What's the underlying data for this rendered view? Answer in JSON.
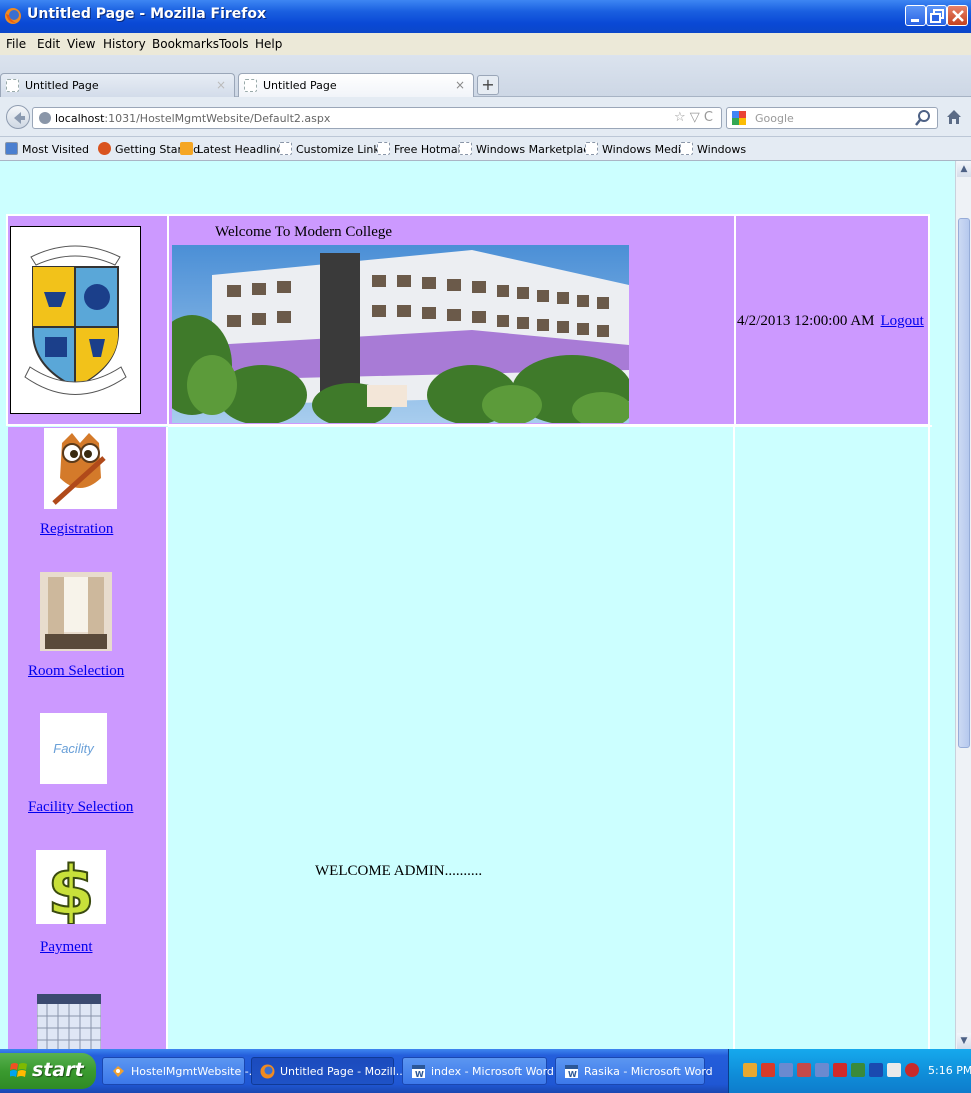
{
  "window": {
    "title": "Untitled Page - Mozilla Firefox"
  },
  "menu": [
    "File",
    "Edit",
    "View",
    "History",
    "Bookmarks",
    "Tools",
    "Help"
  ],
  "tabs": [
    {
      "label": "Untitled Page",
      "active": false
    },
    {
      "label": "Untitled Page",
      "active": true
    }
  ],
  "tab_close": "×",
  "new_tab": "+",
  "nav": {
    "url_host": "localhost",
    "url_path": ":1031/HostelMgmtWebsite/Default2.aspx",
    "url_tools": "☆ ▽ C",
    "search_placeholder": "Google"
  },
  "bookmarks": [
    "Most Visited",
    "Getting Started",
    "Latest Headlines",
    "Customize Links",
    "Free Hotmail",
    "Windows Marketplace",
    "Windows Media",
    "Windows"
  ],
  "page": {
    "welcome_college": "Welcome To Modern College",
    "datetime": "4/2/2013 12:00:00 AM",
    "logout": "Logout",
    "side_links": [
      "Registration",
      "Room Selection",
      "Facility Selection",
      "Payment"
    ],
    "facility_img_text": "Facility",
    "welcome_admin": "WELCOME ADMIN.........."
  },
  "taskbar": {
    "start": "start",
    "buttons": [
      {
        "label": "HostelMgmtWebsite -...",
        "active": false
      },
      {
        "label": "Untitled Page - Mozill...",
        "active": true
      },
      {
        "label": "index - Microsoft Word",
        "active": false
      },
      {
        "label": "Rasika - Microsoft Word",
        "active": false
      }
    ],
    "clock": "5:16 PM"
  },
  "colors": {
    "page_bg": "#ccffff",
    "purple_cell": "#cc99ff",
    "link": "#0000ee",
    "titlebar": "#0a49d6",
    "taskbar": "#245edb",
    "start": "#3a9a2f"
  }
}
